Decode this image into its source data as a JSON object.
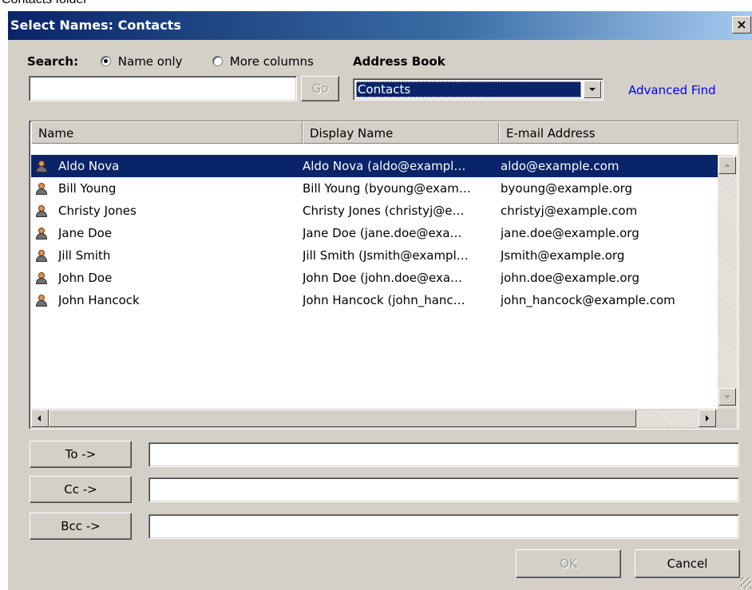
{
  "background_caption": "Contacts folder",
  "window": {
    "title": "Select Names: Contacts",
    "close_glyph": "×"
  },
  "search": {
    "label": "Search:",
    "name_only": "Name only",
    "more_columns": "More columns",
    "selected_option": "Name only",
    "input_value": "",
    "go_button": "Go"
  },
  "address_book": {
    "label": "Address Book",
    "selected": "Contacts"
  },
  "advanced_find": "Advanced Find",
  "columns": [
    "Name",
    "Display Name",
    "E-mail Address"
  ],
  "contacts": [
    {
      "name": "Aldo Nova",
      "display": "Aldo Nova (aldo@exampl…",
      "email": "aldo@example.com",
      "selected": true
    },
    {
      "name": "Bill Young",
      "display": "Bill Young (byoung@exam…",
      "email": "byoung@example.org"
    },
    {
      "name": "Christy Jones",
      "display": "Christy Jones (christyj@e…",
      "email": "christyj@example.com"
    },
    {
      "name": "Jane Doe",
      "display": "Jane Doe (jane.doe@exa…",
      "email": "jane.doe@example.org"
    },
    {
      "name": "Jill Smith",
      "display": "Jill Smith (Jsmith@exampl…",
      "email": "Jsmith@example.org"
    },
    {
      "name": "John Doe",
      "display": "John Doe (john.doe@exa…",
      "email": "john.doe@example.org"
    },
    {
      "name": "John Hancock",
      "display": "John Hancock (john_hanc…",
      "email": "john_hancock@example.com"
    }
  ],
  "recipients": {
    "to": {
      "label": "To ->",
      "value": ""
    },
    "cc": {
      "label": "Cc ->",
      "value": ""
    },
    "bcc": {
      "label": "Bcc ->",
      "value": ""
    }
  },
  "buttons": {
    "ok": "OK",
    "cancel": "Cancel",
    "ok_enabled": false
  },
  "colors": {
    "selection": "#0a246a",
    "dialog_face": "#d4d0c8",
    "link": "#0000ff"
  }
}
